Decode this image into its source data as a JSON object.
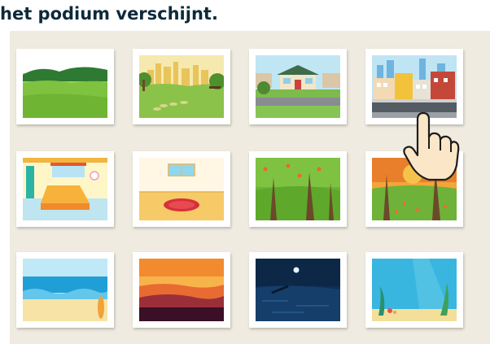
{
  "caption": "het podium verschijnt.",
  "backdrops": [
    {
      "icon": "meadow-backdrop-icon"
    },
    {
      "icon": "city-park-backdrop-icon"
    },
    {
      "icon": "suburb-house-backdrop-icon"
    },
    {
      "icon": "city-street-backdrop-icon"
    },
    {
      "icon": "bedroom-backdrop-icon"
    },
    {
      "icon": "room-rug-backdrop-icon"
    },
    {
      "icon": "green-forest-backdrop-icon"
    },
    {
      "icon": "autumn-forest-backdrop-icon"
    },
    {
      "icon": "beach-backdrop-icon"
    },
    {
      "icon": "sunset-sea-backdrop-icon"
    },
    {
      "icon": "night-sea-backdrop-icon"
    },
    {
      "icon": "underwater-backdrop-icon"
    }
  ],
  "pointer": {
    "icon": "hand-pointer-icon"
  }
}
